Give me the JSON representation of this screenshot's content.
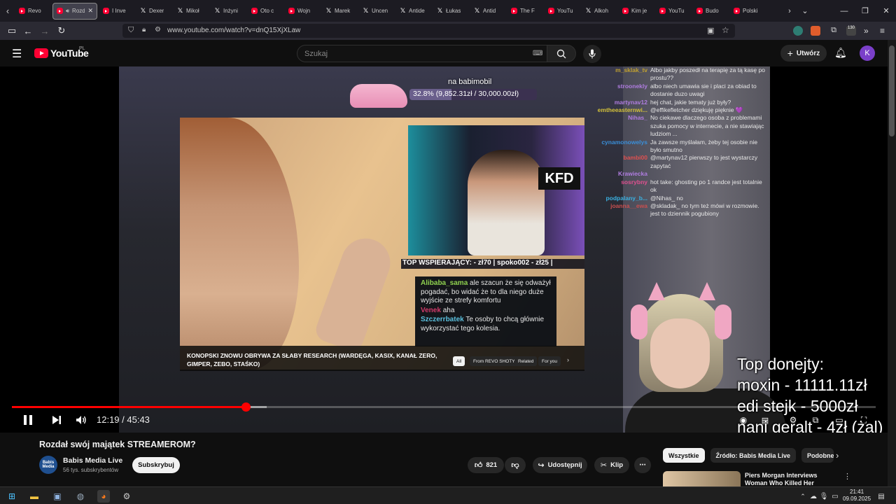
{
  "browser": {
    "tabs": [
      {
        "title": "Revo",
        "icon": "yt-icon"
      },
      {
        "title": "Rozd",
        "icon": "yt-icon",
        "active": true
      },
      {
        "title": "I Inve",
        "icon": "yt-icon"
      },
      {
        "title": "Dexer",
        "icon": "x-icon"
      },
      {
        "title": "Mikoł",
        "icon": "x-icon"
      },
      {
        "title": "Inżyni",
        "icon": "x-icon"
      },
      {
        "title": "Oto c",
        "icon": "yt-icon"
      },
      {
        "title": "Wojn",
        "icon": "yt-icon"
      },
      {
        "title": "Marek",
        "icon": "x-icon"
      },
      {
        "title": "Uncen",
        "icon": "x-icon"
      },
      {
        "title": "Antide",
        "icon": "x-icon"
      },
      {
        "title": "Łukas",
        "icon": "x-icon"
      },
      {
        "title": "Antid",
        "icon": "x-icon"
      },
      {
        "title": "The F",
        "icon": "yt-icon"
      },
      {
        "title": "YouTu",
        "icon": "yt-icon"
      },
      {
        "title": "Alkoh",
        "icon": "x-icon"
      },
      {
        "title": "Kim je",
        "icon": "yt-icon"
      },
      {
        "title": "YouTu",
        "icon": "yt-icon"
      },
      {
        "title": "Budo",
        "icon": "yt-icon"
      },
      {
        "title": "Polski",
        "icon": "yt-icon"
      }
    ],
    "url": "www.youtube.com/watch?v=dnQ15XjXLaw",
    "badge_count": "130"
  },
  "youtube": {
    "wordmark": "YouTube",
    "country": "PL",
    "search_placeholder": "Szukaj",
    "create_label": "Utwórz",
    "avatar_letter": "K"
  },
  "player": {
    "goal_title": "na babimobil",
    "goal_text": "32.8% (9,852.31zł / 30,000.00zł)",
    "goal_percent": 32.8,
    "top_supporters": "TOP WSPIERAJĄCY: - zł70 |    spoko002 - zł25 |",
    "embed_logo": "KFD",
    "embed_chat": [
      {
        "name": "Alibaba_sama",
        "msg": "ale szacun że się odważył pogadać, bo widać że to dla niego duże wyjście ze strefy komfortu",
        "color": "#8fd14f"
      },
      {
        "name": "Venek",
        "msg": "aha",
        "color": "#d23a6a"
      },
      {
        "name": "Szczerrbatek",
        "msg": "Te osoby to chcą głównie wykorzystać tego kolesia.",
        "color": "#5bc0de"
      }
    ],
    "embed_title": "KONOPSKI ZNOWU OBRYWA ZA SŁABY RESEARCH (WARDĘGA, KASIX, KANAŁ ZERO, GIMPER, ZEBO, STAŚKO)",
    "embed_chips": [
      "All",
      "From REVO SHOTY",
      "Related",
      "For you"
    ],
    "stream_chat": [
      {
        "name": "m_sklak_tv",
        "msg": "Albo jakby poszedł na terapię za tą kasę po prostu??",
        "color": "#c0a030"
      },
      {
        "name": "stroonekly",
        "msg": "albo niech umawia sie i placi za obiad to dostanie duzo uwagi",
        "color": "#b07de0"
      },
      {
        "name": "martynav12",
        "msg": "hej chat, jakie tematy już były?",
        "color": "#b07de0"
      },
      {
        "name": "emtheeasternwi...",
        "msg": "@effikefletcher dziękuję pięknie 💜",
        "color": "#d4c23a"
      },
      {
        "name": "Nihas_",
        "msg": "No ciekawe dlaczego osoba z problemami szuka pomocy w internecie, a nie stawiając ludziom ...",
        "color": "#b07de0"
      },
      {
        "name": "cynamonowelys",
        "msg": "Ja zawsze myślałam, żeby tej osobie nie było smutno",
        "color": "#3a8fd9"
      },
      {
        "name": "bambi00",
        "msg": "@martynav12 pierwszy to jest wystarczy zapytać",
        "color": "#e05050"
      },
      {
        "name": "Krawiecka",
        "msg": "",
        "color": "#b07de0"
      },
      {
        "name": "sosrybny",
        "msg": "hot take: ghosting po 1 randce jest totalnie ok",
        "color": "#e05090"
      },
      {
        "name": "podpalany_b...",
        "msg": "@Nihas_ no",
        "color": "#3ab0e0"
      },
      {
        "name": "joanna__ewa",
        "msg": "@skladak_ no tym też mówi w rozmowie. jest to dziennik pogubiony",
        "color": "#c94f4f"
      }
    ],
    "donations": [
      "Top donejty:",
      "moxin - 11111.11zł",
      "edi stejk - 5000zł",
      "nani geralt - 4zł (żal)"
    ],
    "time": "12:19 / 45:43",
    "progress_fraction": 0.271,
    "buffer_fraction": 0.295
  },
  "video": {
    "title": "Rozdał swój majątek STREAMEROM?",
    "channel_name": "Babis Media Live",
    "channel_avatar_text": "Babis Media",
    "subscribers": "56 tys. subskrybentów",
    "subscribe_label": "Subskrybuj",
    "likes": "821",
    "share_label": "Udostępnij",
    "clip_label": "Klip",
    "more_label": "⋯"
  },
  "recommendations": {
    "chips": [
      "Wszystkie",
      "Źródło: Babis Media Live",
      "Podobne"
    ],
    "first_title": "Piers Morgan Interviews Woman Who Killed Her Entire..."
  },
  "taskbar": {
    "time": "21:41",
    "date": "09.09.2025"
  }
}
